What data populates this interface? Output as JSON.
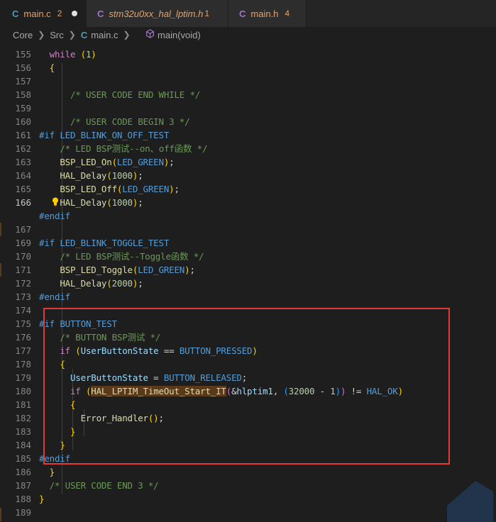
{
  "tabs": [
    {
      "icon": "C",
      "name": "main.c",
      "badge": "2",
      "modified": true,
      "active": true
    },
    {
      "icon": "C",
      "name": "stm32u0xx_hal_lptim.h",
      "badge": "1",
      "italic": true
    },
    {
      "icon": "C",
      "name": "main.h",
      "badge": "4"
    }
  ],
  "breadcrumb": {
    "items": [
      "Core",
      "Src",
      "main.c",
      "main(void)"
    ]
  },
  "lines": [
    {
      "n": "155",
      "html": "<span class=\"kw\">while</span> <span class=\"p1\">(</span><span class=\"nm\">1</span><span class=\"p1\">)</span>",
      "indent": 1
    },
    {
      "n": "156",
      "html": "<span class=\"p1\">{</span>",
      "indent": 1
    },
    {
      "n": "157",
      "html": ""
    },
    {
      "n": "158",
      "html": "    <span class=\"cm\">/* USER CODE END WHILE */</span>",
      "indent": 1
    },
    {
      "n": "159",
      "html": ""
    },
    {
      "n": "160",
      "html": "    <span class=\"cm\">/* USER CODE BEGIN 3 */</span>",
      "indent": 1
    },
    {
      "n": "161",
      "html": "<span class=\"pp\">#if</span> <span class=\"mac\">LED_BLINK_ON_OFF_TEST</span>"
    },
    {
      "n": "162",
      "html": "    <span class=\"cm\">/* LED BSP测试--on、off函数 */</span>"
    },
    {
      "n": "163",
      "html": "    <span class=\"fn\">BSP_LED_On</span><span class=\"p1\">(</span><span class=\"mac\">LED_GREEN</span><span class=\"p1\">)</span>;"
    },
    {
      "n": "164",
      "html": "    <span class=\"fn\">HAL_Delay</span><span class=\"p1\">(</span><span class=\"nm\">1000</span><span class=\"p1\">)</span>;"
    },
    {
      "n": "165",
      "html": "    <span class=\"fn\">BSP_LED_Off</span><span class=\"p1\">(</span><span class=\"mac\">LED_GREEN</span><span class=\"p1\">)</span>;"
    },
    {
      "n": "166",
      "html": "    <span class=\"fn\">HAL_Delay</span><span class=\"p1\">(</span><span class=\"nm\">1000</span><span class=\"p1\">)</span>;",
      "active": true
    },
    {
      "n": "",
      "html": "<span class=\"pp\">#endif</span>"
    },
    {
      "n": "167",
      "html": ""
    },
    {
      "n": "169",
      "html": "<span class=\"pp\">#if</span> <span class=\"mac\">LED_BLINK_TOGGLE_TEST</span>"
    },
    {
      "n": "170",
      "html": "    <span class=\"cm\">/* LED BSP测试--Toggle函数 */</span>"
    },
    {
      "n": "171",
      "html": "    <span class=\"fn\">BSP_LED_Toggle</span><span class=\"p1\">(</span><span class=\"mac\">LED_GREEN</span><span class=\"p1\">)</span>;"
    },
    {
      "n": "172",
      "html": "    <span class=\"fn\">HAL_Delay</span><span class=\"p1\">(</span><span class=\"nm\">2000</span><span class=\"p1\">)</span>;"
    },
    {
      "n": "173",
      "html": "<span class=\"pp\">#endif</span>"
    },
    {
      "n": "174",
      "html": ""
    },
    {
      "n": "175",
      "html": "<span class=\"pp\">#if</span> <span class=\"mac\">BUTTON_TEST</span>"
    },
    {
      "n": "176",
      "html": "    <span class=\"cm\">/* BUTTON BSP测试 */</span>"
    },
    {
      "n": "177",
      "html": "    <span class=\"kw\">if</span> <span class=\"p1\">(</span><span class=\"var\">UserButtonState</span> == <span class=\"mac\">BUTTON_PRESSED</span><span class=\"p1\">)</span>"
    },
    {
      "n": "178",
      "html": "    <span class=\"p1\">{</span>"
    },
    {
      "n": "179",
      "html": "      <span class=\"var\">UserButtonState</span> = <span class=\"mac\">BUTTON_RELEASED</span>;"
    },
    {
      "n": "180",
      "html": "      <span class=\"kw\">if</span> <span class=\"p1\">(</span><span class=\"fn hl\">HAL_LPTIM_TimeOut_Start_IT</span><span class=\"p2\">(</span>&amp;<span class=\"var\">hlptim1</span>, <span class=\"p3\">(</span><span class=\"nm\">32000</span> - <span class=\"nm\">1</span><span class=\"p3\">)</span><span class=\"p2\">)</span> != <span class=\"mac\">HAL_OK</span><span class=\"p1\">)</span>"
    },
    {
      "n": "181",
      "html": "      <span class=\"p1\">{</span>"
    },
    {
      "n": "182",
      "html": "        <span class=\"fn\">Error_Handler</span><span class=\"p1\">()</span>;"
    },
    {
      "n": "183",
      "html": "      <span class=\"p1\">}</span>"
    },
    {
      "n": "184",
      "html": "    <span class=\"p1\">}</span>"
    },
    {
      "n": "185",
      "html": "<span class=\"pp\">#endif</span>"
    },
    {
      "n": "186",
      "html": "  <span class=\"p1\">}</span>"
    },
    {
      "n": "187",
      "html": "  <span class=\"cm\">/* USER CODE END 3 */</span>"
    },
    {
      "n": "188",
      "html": "<span class=\"p1\">}</span>"
    },
    {
      "n": "189",
      "html": ""
    }
  ]
}
